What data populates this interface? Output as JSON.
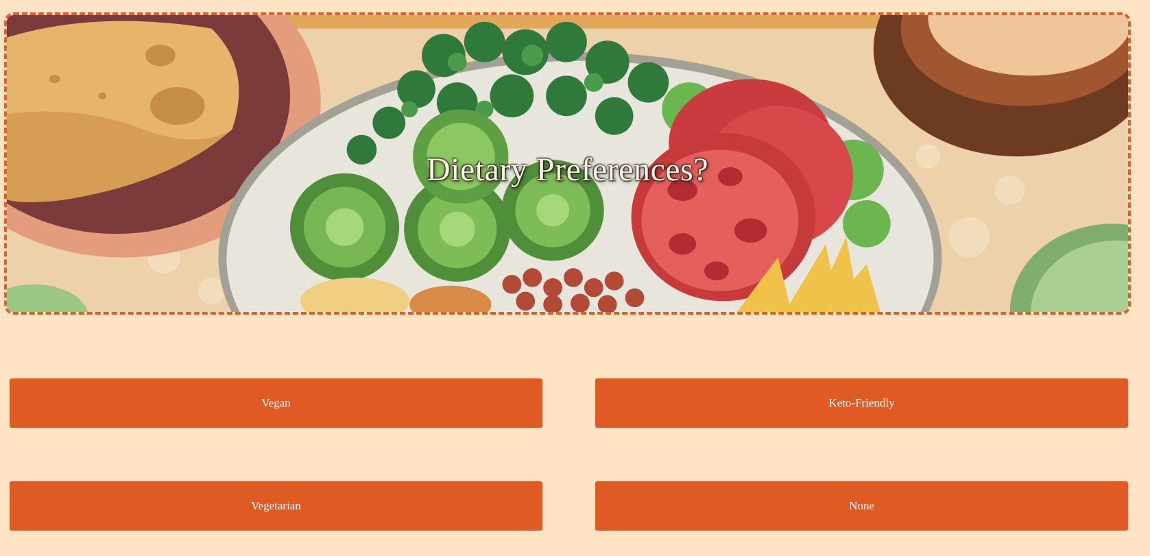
{
  "hero": {
    "title": "Dietary Preferences?"
  },
  "options": {
    "vegan": "Vegan",
    "keto": "Keto-Friendly",
    "vegetarian": "Vegetarian",
    "none": "None"
  },
  "colors": {
    "background": "#ffe3c4",
    "accent": "#e05a24",
    "border": "#e0602a",
    "button_text": "#ffffff"
  }
}
